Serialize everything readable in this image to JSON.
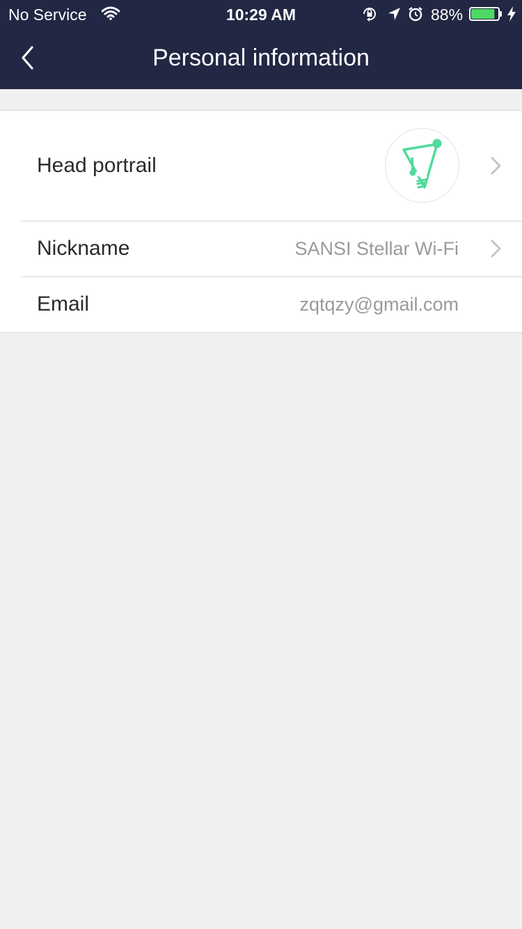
{
  "status_bar": {
    "carrier": "No Service",
    "time": "10:29 AM",
    "battery_percent": "88%",
    "battery_level": 0.88,
    "battery_color": "#4cd964"
  },
  "nav": {
    "title": "Personal information",
    "back_icon": "chevron-left-icon"
  },
  "profile": {
    "rows": [
      {
        "label": "Head portrail",
        "avatar_icon": "lightbulb-logo-icon",
        "accent": "#4ddb9a"
      },
      {
        "label": "Nickname",
        "value": "SANSI Stellar Wi-Fi"
      },
      {
        "label": "Email",
        "value": "zqtqzy@gmail.com"
      }
    ]
  },
  "colors": {
    "header_bg": "#222744",
    "page_bg": "#f0f0f0",
    "accent": "#4ddb9a"
  }
}
